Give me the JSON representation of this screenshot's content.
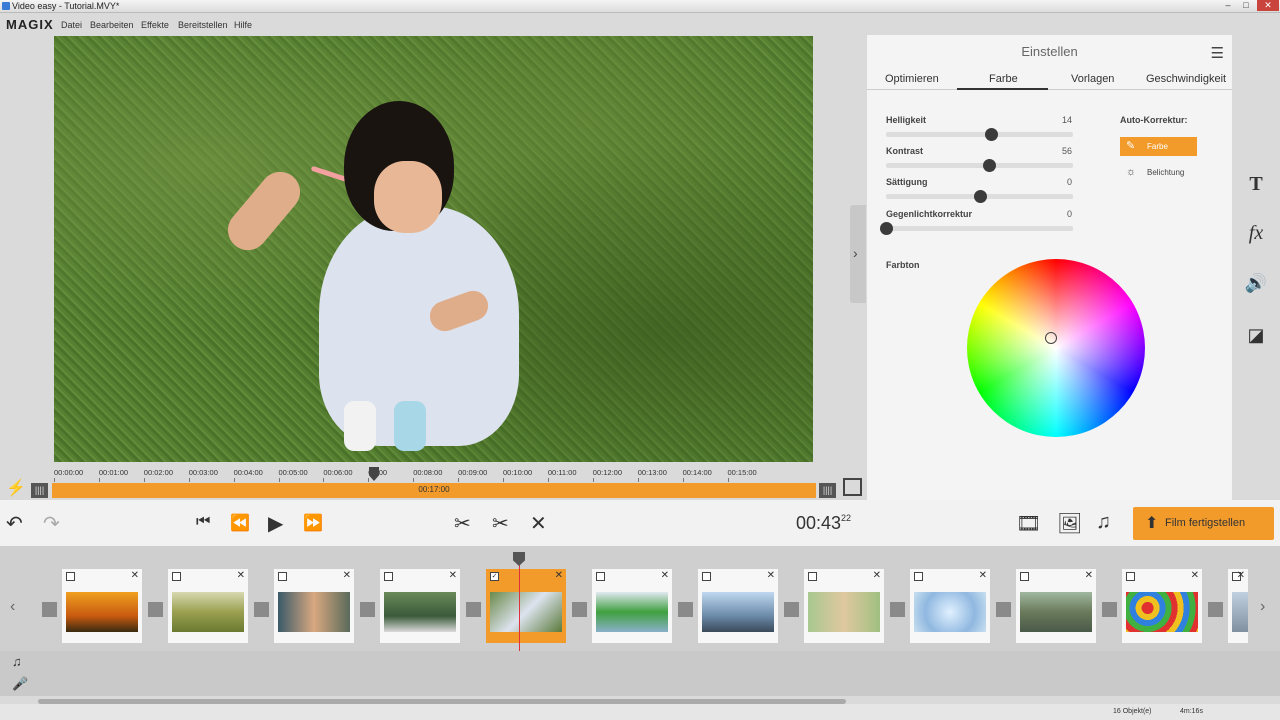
{
  "window": {
    "title": "Video easy - Tutorial.MVY*",
    "controls": [
      "–",
      "□",
      "✕"
    ]
  },
  "menubar": {
    "logo": "MAGIX",
    "items": [
      "Datei",
      "Bearbeiten",
      "Effekte",
      "Bereitstellen",
      "Hilfe"
    ]
  },
  "panel": {
    "title": "Einstellen",
    "tabs": [
      "Optimieren",
      "Farbe",
      "Vorlagen",
      "Geschwindigkeit"
    ],
    "active_tab": "Farbe",
    "sliders": [
      {
        "label": "Helligkeit",
        "value": "14",
        "position": 0.56
      },
      {
        "label": "Kontrast",
        "value": "56",
        "position": 0.55
      },
      {
        "label": "Sättigung",
        "value": "0",
        "position": 0.5
      },
      {
        "label": "Gegenlichtkorrektur",
        "value": "0",
        "position": 0.0
      }
    ],
    "auto_correction": {
      "title": "Auto-Korrektur:",
      "buttons": [
        "Farbe",
        "Belichtung"
      ]
    },
    "hue_label": "Farbton"
  },
  "ruler": {
    "ticks": [
      "00:00:00",
      "00:01:00",
      "00:02:00",
      "00:03:00",
      "00:04:00",
      "00:05:00",
      "00:06:00",
      "07:00",
      "00:08:00",
      "00:09:00",
      "00:10:00",
      "00:11:00",
      "00:12:00",
      "00:13:00",
      "00:14:00",
      "00:15:00"
    ],
    "range_label": "00:17:00"
  },
  "transport": {
    "timecode": "00:43",
    "frames": "22",
    "finish_label": "Film fertigstellen"
  },
  "storyboard": {
    "clips": [
      {
        "thumb": "sunset",
        "checked": false
      },
      {
        "thumb": "field",
        "checked": false
      },
      {
        "thumb": "girl-bubbles",
        "checked": false
      },
      {
        "thumb": "girl-park",
        "checked": false
      },
      {
        "thumb": "girl-grass",
        "checked": true,
        "selected": true
      },
      {
        "thumb": "boy-green",
        "checked": false
      },
      {
        "thumb": "fishing",
        "checked": false
      },
      {
        "thumb": "boy-bubbles",
        "checked": false
      },
      {
        "thumb": "bubble",
        "checked": false
      },
      {
        "thumb": "path",
        "checked": false
      },
      {
        "thumb": "balls",
        "checked": false
      },
      {
        "thumb": "partial",
        "checked": false
      }
    ]
  },
  "status": {
    "objects": "16 Objekt(e)",
    "duration": "4m:16s"
  },
  "colors": {
    "accent": "#f29b2b",
    "playline": "#e0303c"
  }
}
